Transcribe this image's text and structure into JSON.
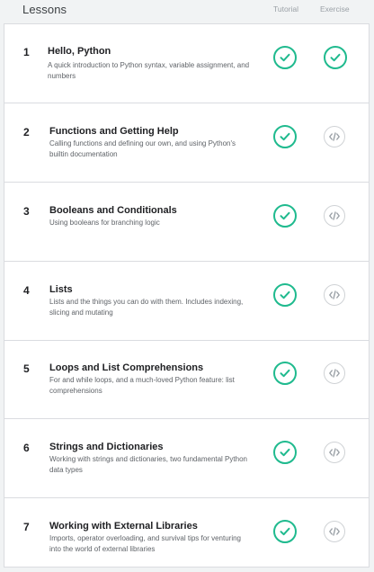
{
  "header": {
    "title": "Lessons",
    "col_tutorial": "Tutorial",
    "col_exercise": "Exercise"
  },
  "colors": {
    "done": "#1fba8e",
    "todo": "#cfd2d5",
    "text": "#202124",
    "muted": "#5f6368"
  },
  "lessons": [
    {
      "num": "1",
      "title": "Hello, Python",
      "desc": "A quick introduction to Python syntax, variable assignment, and numbers",
      "tutorial": "complete",
      "exercise": "complete"
    },
    {
      "num": "2",
      "title": "Functions and Getting Help",
      "desc": "Calling functions and defining our own, and using Python's builtin documentation",
      "tutorial": "complete",
      "exercise": "incomplete"
    },
    {
      "num": "3",
      "title": "Booleans and Conditionals",
      "desc": "Using booleans for branching logic",
      "tutorial": "complete",
      "exercise": "incomplete"
    },
    {
      "num": "4",
      "title": "Lists",
      "desc": "Lists and the things you can do with them. Includes indexing, slicing and mutating",
      "tutorial": "complete",
      "exercise": "incomplete"
    },
    {
      "num": "5",
      "title": "Loops and List Comprehensions",
      "desc": "For and while loops, and a much-loved Python feature: list comprehensions",
      "tutorial": "complete",
      "exercise": "incomplete"
    },
    {
      "num": "6",
      "title": "Strings and Dictionaries",
      "desc": "Working with strings and dictionaries, two fundamental Python data types",
      "tutorial": "complete",
      "exercise": "incomplete"
    },
    {
      "num": "7",
      "title": "Working with External Libraries",
      "desc": "Imports, operator overloading, and survival tips for venturing into the world of external libraries",
      "tutorial": "complete",
      "exercise": "incomplete"
    }
  ]
}
